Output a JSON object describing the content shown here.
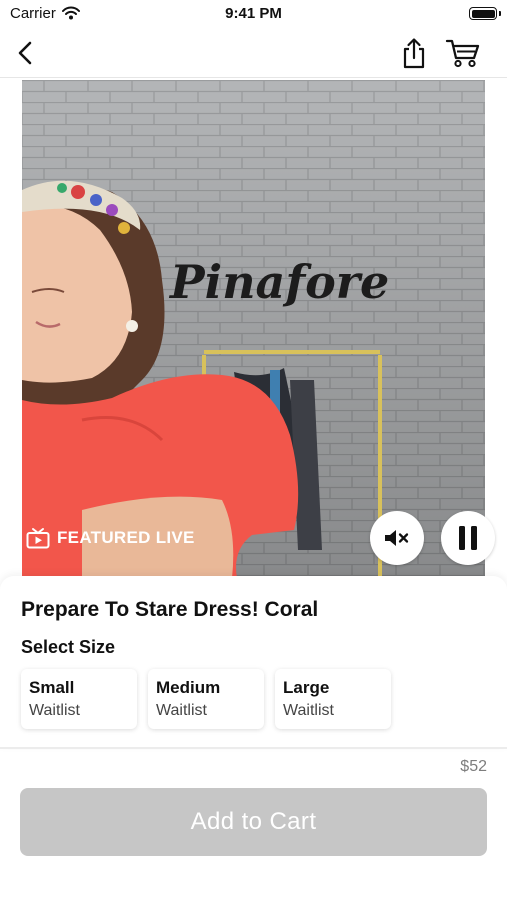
{
  "status_bar": {
    "carrier": "Carrier",
    "time": "9:41 PM"
  },
  "video": {
    "badge_label": "FEATURED LIVE",
    "wall_sign": "Pinafore",
    "icons": {
      "badge": "tv-play-icon",
      "mute": "speaker-muted-icon",
      "pause": "pause-icon"
    }
  },
  "nav": {
    "icons": {
      "back": "chevron-left-icon",
      "share": "share-icon",
      "cart": "cart-icon"
    }
  },
  "product": {
    "title": "Prepare To Stare Dress! Coral",
    "size_heading": "Select Size",
    "sizes": [
      {
        "name": "Small",
        "status": "Waitlist"
      },
      {
        "name": "Medium",
        "status": "Waitlist"
      },
      {
        "name": "Large",
        "status": "Waitlist"
      }
    ],
    "price": "$52",
    "add_to_cart_label": "Add to Cart"
  },
  "colors": {
    "button_disabled": "#c6c6c6",
    "price_text": "#7d7d7d",
    "dress_coral": "#f2564b"
  }
}
